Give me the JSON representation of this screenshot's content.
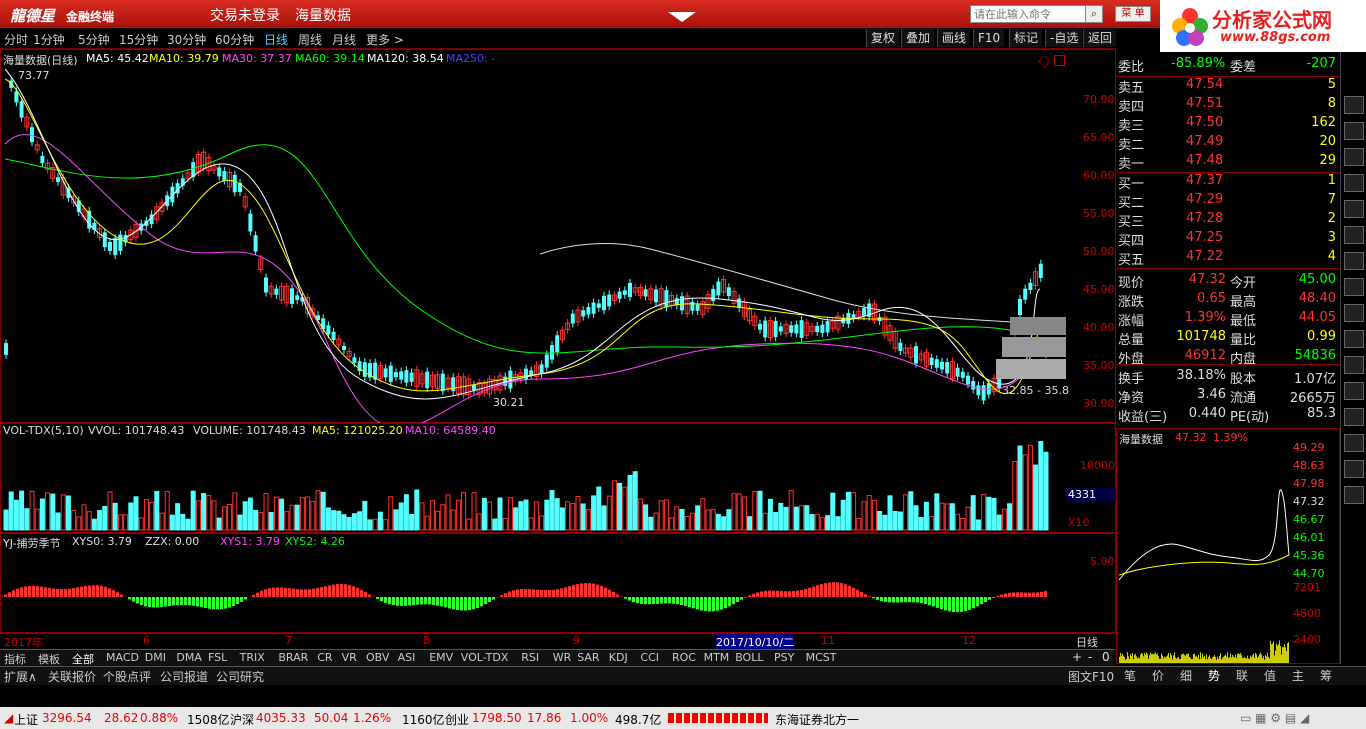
{
  "app": {
    "logo": "龍德星",
    "brand": "金融终端",
    "login": "交易未登录",
    "menu_data": "海量数据",
    "command_placeholder": "请在此输入命令",
    "menu_btn": "菜 单"
  },
  "watermark": {
    "title": "分析家公式网",
    "url": "www.88gs.com"
  },
  "periods": [
    "分时",
    "1分钟",
    "5分钟",
    "15分钟",
    "30分钟",
    "60分钟",
    "日线",
    "周线",
    "月线",
    "更多 >"
  ],
  "active_period": "日线",
  "toolbar": [
    "复权",
    "叠加",
    "画线",
    "F10",
    "标记",
    "-自选",
    "返回"
  ],
  "main_legend": {
    "name": "海量数据(日线)",
    "ma5": "MA5: 45.42",
    "ma10": "MA10: 39.79",
    "ma30": "MA30: 37.37",
    "ma60": "MA60: 39.14",
    "ma120": "MA120: 38.54",
    "ma250": "MA250: -"
  },
  "price_annotations": {
    "high": "73.77",
    "low": "30.21",
    "range": "32.85 - 35.8"
  },
  "price_axis": [
    "70.00",
    "65.00",
    "60.00",
    "55.00",
    "50.00",
    "45.00",
    "40.00",
    "35.00",
    "30.00"
  ],
  "vol_legend": {
    "name": "VOL-TDX(5,10)",
    "vvol": "VVOL: 101748.43",
    "volume": "VOLUME: 101748.43",
    "ma5": "MA5: 121025.20",
    "ma10": "MA10: 64589.40"
  },
  "vol_axis": {
    "top": "10000",
    "cursor": "4331",
    "unit": "X10"
  },
  "ind_legend": {
    "name": "YJ-捕劳季节",
    "xys0": "XYS0: 3.79",
    "zzx": "ZZX: 0.00",
    "xys1": "XYS1: 3.79",
    "xys2": "XYS2: 4.26"
  },
  "ind_axis": {
    "top": "5.00"
  },
  "time_axis": [
    "2017年",
    "6",
    "7",
    "8",
    "9",
    "2017/10/10/二",
    "11",
    "12"
  ],
  "time_period_label": "日线",
  "indicator_tabs": [
    "指标",
    "模板",
    "全部",
    "MACD",
    "DMI",
    "DMA",
    "FSL",
    "TRIX",
    "BRAR",
    "CR",
    "VR",
    "OBV",
    "ASI",
    "EMV",
    "VOL-TDX",
    "RSI",
    "WR",
    "SAR",
    "KDJ",
    "CCI",
    "ROC",
    "MTM",
    "BOLL",
    "PSY",
    "MCST"
  ],
  "ext_tabs": [
    "扩展∧",
    "关联报价",
    "个股点评",
    "公司报道",
    "公司研究"
  ],
  "ext_right": "图文F10",
  "quote": {
    "weibi": {
      "label": "委比",
      "value": "-85.89%",
      "label2": "委差",
      "value2": "-207"
    },
    "sells": [
      {
        "label": "卖五",
        "price": "47.54",
        "vol": "5"
      },
      {
        "label": "卖四",
        "price": "47.51",
        "vol": "8"
      },
      {
        "label": "卖三",
        "price": "47.50",
        "vol": "162"
      },
      {
        "label": "卖二",
        "price": "47.49",
        "vol": "20"
      },
      {
        "label": "卖一",
        "price": "47.48",
        "vol": "29"
      }
    ],
    "buys": [
      {
        "label": "买一",
        "price": "47.37",
        "vol": "1"
      },
      {
        "label": "买二",
        "price": "47.29",
        "vol": "7"
      },
      {
        "label": "买三",
        "price": "47.28",
        "vol": "2"
      },
      {
        "label": "买四",
        "price": "47.25",
        "vol": "3"
      },
      {
        "label": "买五",
        "price": "47.22",
        "vol": "4"
      }
    ],
    "stats": [
      {
        "l1": "现价",
        "v1": "47.32",
        "l2": "今开",
        "v2": "45.00"
      },
      {
        "l1": "涨跌",
        "v1": "0.65",
        "l2": "最高",
        "v2": "48.40"
      },
      {
        "l1": "涨幅",
        "v1": "1.39%",
        "l2": "最低",
        "v2": "44.05"
      },
      {
        "l1": "总量",
        "v1": "101748",
        "l2": "量比",
        "v2": "0.99"
      },
      {
        "l1": "外盘",
        "v1": "46912",
        "l2": "内盘",
        "v2": "54836"
      }
    ],
    "fund": [
      {
        "l1": "换手",
        "v1": "38.18%",
        "l2": "股本",
        "v2": "1.07亿"
      },
      {
        "l1": "净资",
        "v1": "3.46",
        "l2": "流通",
        "v2": "2665万"
      },
      {
        "l1": "收益(三)",
        "v1": "0.440",
        "l2": "PE(动)",
        "v2": "85.3"
      }
    ]
  },
  "mini": {
    "title": "海量数据",
    "price": "47.32",
    "pct": "1.39%",
    "axis": [
      "49.29",
      "48.63",
      "47.98",
      "47.32",
      "46.67",
      "46.01",
      "45.36",
      "44.70"
    ],
    "vol_axis": [
      "7201",
      "4800",
      "2400"
    ]
  },
  "mini_tabs": [
    "笔",
    "价",
    "细",
    "势",
    "联",
    "值",
    "主",
    "筹"
  ],
  "status": {
    "sh_name": "上证",
    "sh_val": "3296.54",
    "sh_chg": "28.62",
    "sh_pct": "0.88%",
    "sh_amt": "1508亿",
    "sz_name": "沪深",
    "sz_val": "4035.33",
    "sz_chg": "50.04",
    "sz_pct": "1.26%",
    "sz_amt": "1160亿",
    "cy_name": "创业",
    "cy_val": "1798.50",
    "cy_chg": "17.86",
    "cy_pct": "1.00%",
    "cy_amt": "498.7亿",
    "broker": "东海证券北方一"
  },
  "icons": [
    "cn-icon",
    "gift-icon",
    "chart-icon",
    "chart-icon",
    "fill-icon",
    "up-icon",
    "down-icon",
    "f10-icon",
    "lines-icon",
    "grid-icon",
    "search-icon",
    "rsi-icon",
    "arrow-icon",
    "expand-icon",
    "chart-icon",
    "edit-icon"
  ],
  "colors": {
    "up": "#ff3030",
    "down": "#54ffff",
    "ma5": "#ffffff",
    "ma10": "#ffff00",
    "ma30": "#ff40ff",
    "ma60": "#00ff00",
    "ma120": "#ffffff"
  }
}
